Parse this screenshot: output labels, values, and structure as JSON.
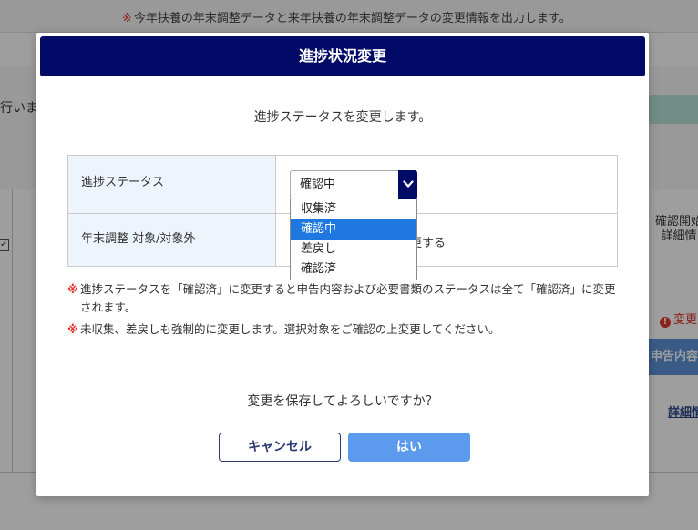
{
  "background": {
    "top_note_mark": "※",
    "top_note": "今年扶養の年末調整データと来年扶養の年末調整データの変更情報を出力します。",
    "left_text": "行います",
    "right_header": "確認開始\n詳細情",
    "change_badge": "変更",
    "detail_button": "申告内容",
    "detail_link": "詳細情"
  },
  "modal": {
    "title": "進捗状況変更",
    "lead": "進捗ステータスを変更します。",
    "form": {
      "status_label": "進捗ステータス",
      "status_selected": "確認中",
      "year_end_label": "年末調整 対象/対象外",
      "year_end_value_partial": "更する"
    },
    "dropdown_options": [
      "収集済",
      "確認中",
      "差戻し",
      "確認済"
    ],
    "dropdown_active_index": 1,
    "notes": [
      {
        "mark": "※",
        "text": "進捗ステータスを「確認済」に変更すると申告内容および必要書類のステータスは全て「確認済」に変更されます。"
      },
      {
        "mark": "※",
        "text": "未収集、差戻しも強制的に変更します。選択対象をご確認の上変更してください。"
      }
    ],
    "confirm_text": "変更を保存してよろしいですか？",
    "cancel_label": "キャンセル",
    "ok_label": "はい"
  },
  "colors": {
    "header_navy": "#010a66",
    "accent_blue": "#1e78e0",
    "ok_button": "#5b9aed",
    "note_red": "#e0382e",
    "label_bg": "#eef4fb"
  },
  "icons": {
    "select_arrow": "chevron-down-icon",
    "alert": "exclamation-icon"
  }
}
